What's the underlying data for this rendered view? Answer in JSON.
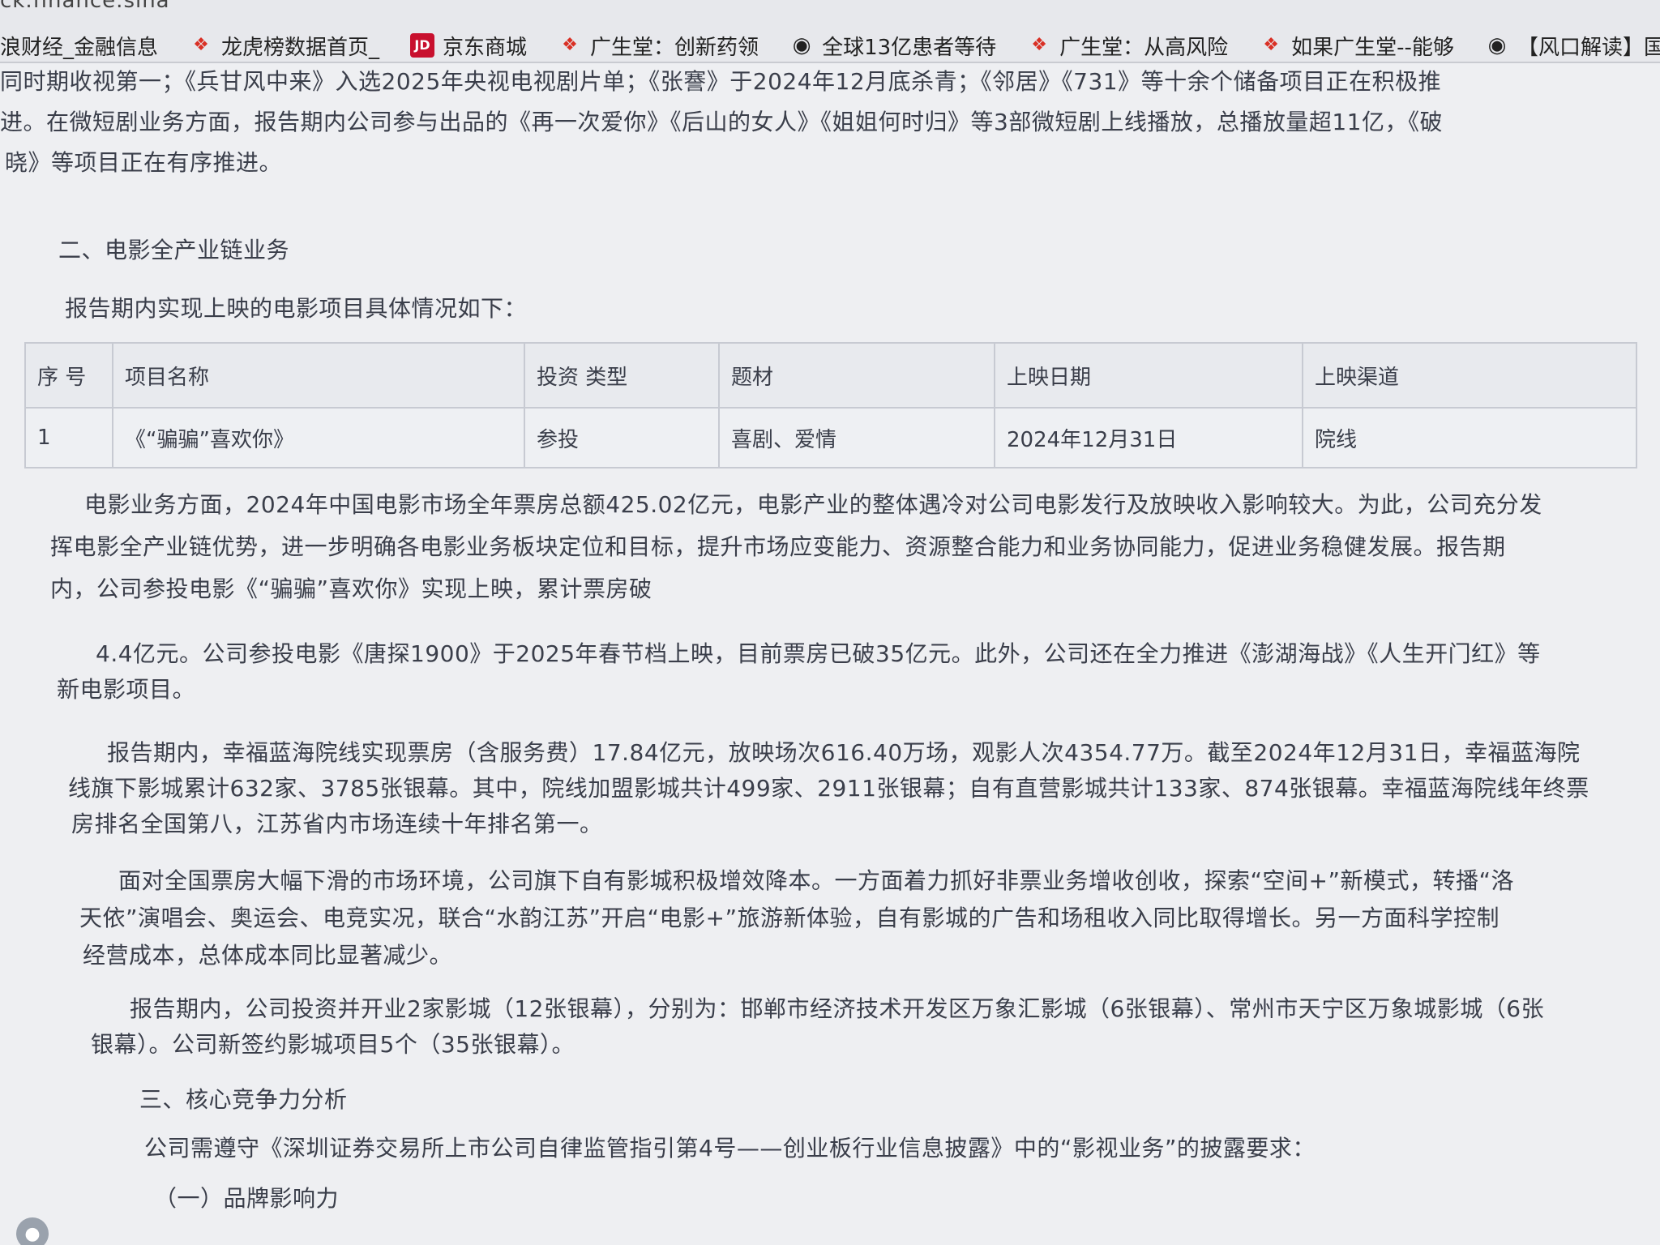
{
  "browser": {
    "url_fragment": "ck.finance.sina",
    "bookmarks": [
      {
        "icon": "none",
        "label": "浪财经_金融信息"
      },
      {
        "icon": "flame-icon",
        "label": "龙虎榜数据首页_"
      },
      {
        "icon": "jd-logo-icon",
        "label": "京东商城"
      },
      {
        "icon": "flame-icon",
        "label": "广生堂：创新药领"
      },
      {
        "icon": "weibo-icon",
        "label": "全球13亿患者等待"
      },
      {
        "icon": "flame-icon",
        "label": "广生堂：从高风险"
      },
      {
        "icon": "flame-icon",
        "label": "如果广生堂--能够"
      },
      {
        "icon": "weibo-icon",
        "label": "【风口解读】国"
      }
    ]
  },
  "document": {
    "top_lines": [
      "同时期收视第一；《兵甘风中来》入选2025年央视电视剧片单；《张謇》于2024年12月底杀青；《邻居》《731》等十余个储备项目正在积极推",
      "进。在微短剧业务方面，报告期内公司参与出品的《再一次爱你》《后山的女人》《姐姐何时归》等3部微短剧上线播放，总播放量超11亿，《破",
      "晓》等项目正在有序推进。"
    ],
    "section2_title": "二、电影全产业链业务",
    "table_intro": "报告期内实现上映的电影项目具体情况如下：",
    "table": {
      "headers": [
        "序 号",
        "项目名称",
        "投资 类型",
        "题材",
        "上映日期",
        "上映渠道"
      ],
      "rows": [
        [
          "1",
          "《“骗骗”喜欢你》",
          "参投",
          "喜剧、爱情",
          "2024年12月31日",
          "院线"
        ]
      ]
    },
    "para1": [
      "电影业务方面，2024年中国电影市场全年票房总额425.02亿元，电影产业的整体遇冷对公司电影发行及放映收入影响较大。为此，公司充分发",
      "挥电影全产业链优势，进一步明确各电影业务板块定位和目标，提升市场应变能力、资源整合能力和业务协同能力，促进业务稳健发展。报告期",
      "内，公司参投电影《“骗骗”喜欢你》实现上映，累计票房破"
    ],
    "para2": [
      "4.4亿元。公司参投电影《唐探1900》于2025年春节档上映，目前票房已破35亿元。此外，公司还在全力推进《澎湖海战》《人生开门红》等",
      "新电影项目。"
    ],
    "para3": [
      "报告期内，幸福蓝海院线实现票房（含服务费）17.84亿元，放映场次616.40万场，观影人次4354.77万。截至2024年12月31日，幸福蓝海院",
      "线旗下影城累计632家、3785张银幕。其中，院线加盟影城共计499家、2911张银幕；自有直营影城共计133家、874张银幕。幸福蓝海院线年终票",
      "房排名全国第八，江苏省内市场连续十年排名第一。"
    ],
    "para4": [
      "面对全国票房大幅下滑的市场环境，公司旗下自有影城积极增效降本。一方面着力抓好非票业务增收创收，探索“空间+”新模式，转播“洛",
      "天依”演唱会、奥运会、电竞实况，联合“水韵江苏”开启“电影+”旅游新体验，自有影城的广告和场租收入同比取得增长。另一方面科学控制",
      "经营成本，总体成本同比显著减少。"
    ],
    "para5": [
      "报告期内，公司投资并开业2家影城（12张银幕），分别为：邯郸市经济技术开发区万象汇影城（6张银幕）、常州市天宁区万象城影城（6张",
      "银幕）。公司新签约影城项目5个（35张银幕）。"
    ],
    "section3_title": "三、核心竞争力分析",
    "para6": "公司需遵守《深圳证券交易所上市公司自律监管指引第4号——创业板行业信息披露》中的“影视业务”的披露要求：",
    "subsection1_title": "（一）品牌影响力"
  }
}
